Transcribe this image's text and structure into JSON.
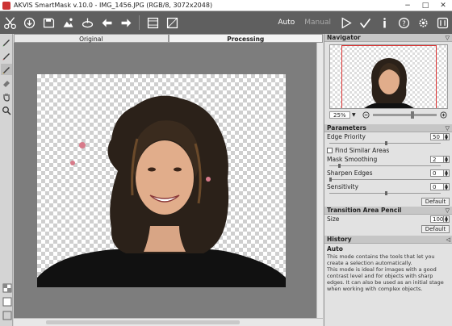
{
  "window": {
    "title": "AKVIS SmartMask v.10.0 - IMG_1456.JPG (RGB/8, 3072x2048)",
    "buttons": [
      "−",
      "□",
      "✕"
    ]
  },
  "toolbar": {
    "mode_auto": "Auto",
    "mode_manual": "Manual"
  },
  "tabs": {
    "original": "Original",
    "processing": "Processing"
  },
  "navigator": {
    "title": "Navigator",
    "zoom": "25%"
  },
  "parameters": {
    "title": "Parameters",
    "edge_priority": {
      "label": "Edge Priority",
      "value": "50"
    },
    "find_similar": {
      "label": "Find Similar Areas"
    },
    "mask_smoothing": {
      "label": "Mask Smoothing",
      "value": "2"
    },
    "sharpen_edges": {
      "label": "Sharpen Edges",
      "value": "0"
    },
    "sensitivity": {
      "label": "Sensitivity",
      "value": "0"
    },
    "default_label": "Default"
  },
  "transition_pencil": {
    "title": "Transition Area Pencil",
    "size": {
      "label": "Size",
      "value": "100"
    },
    "default_label": "Default"
  },
  "history": {
    "title": "History",
    "subtitle": "Auto",
    "text1": "This mode contains the tools that let you create a selection automatically.",
    "text2": "This mode is ideal for images with a good contrast level and for objects with sharp edges. It can also be used as an initial stage when working with complex objects."
  },
  "colors": {
    "toolbar_bg": "#5f5f5f",
    "canvas_bg": "#7d7d7d",
    "panel_bg": "#e2e2e2",
    "nav_frame": "#dd3333"
  }
}
